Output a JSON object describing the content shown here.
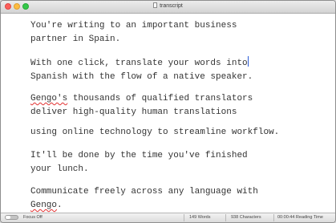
{
  "window": {
    "title": "transcript"
  },
  "editor": {
    "paragraphs": [
      {
        "lines": [
          "You're writing to an important business",
          "partner in Spain."
        ]
      },
      {
        "lines": [
          "With one click, translate your words into",
          "Spanish with the flow of a native speaker."
        ]
      },
      {
        "misspelled_word": "Gengo's",
        "first_line_rest": " thousands of qualified translators",
        "lines": [
          "deliver high-quality human translations"
        ]
      },
      {
        "lines": [
          "using online technology to streamline workflow."
        ]
      },
      {
        "lines": [
          "It'll be done by the time you've finished",
          "your lunch."
        ]
      },
      {
        "first_line": "Communicate freely across any language with",
        "misspelled_word": "Gengo",
        "last_rest": "."
      }
    ]
  },
  "status": {
    "focus_label": "Focus Off",
    "focus_enabled": false,
    "words": "149 Words",
    "characters": "938 Characters",
    "reading_time": "00:00:44 Reading Time"
  },
  "colors": {
    "spellcheck_underline": "#e23030",
    "caret": "#2a5bd7",
    "text": "#333333"
  }
}
